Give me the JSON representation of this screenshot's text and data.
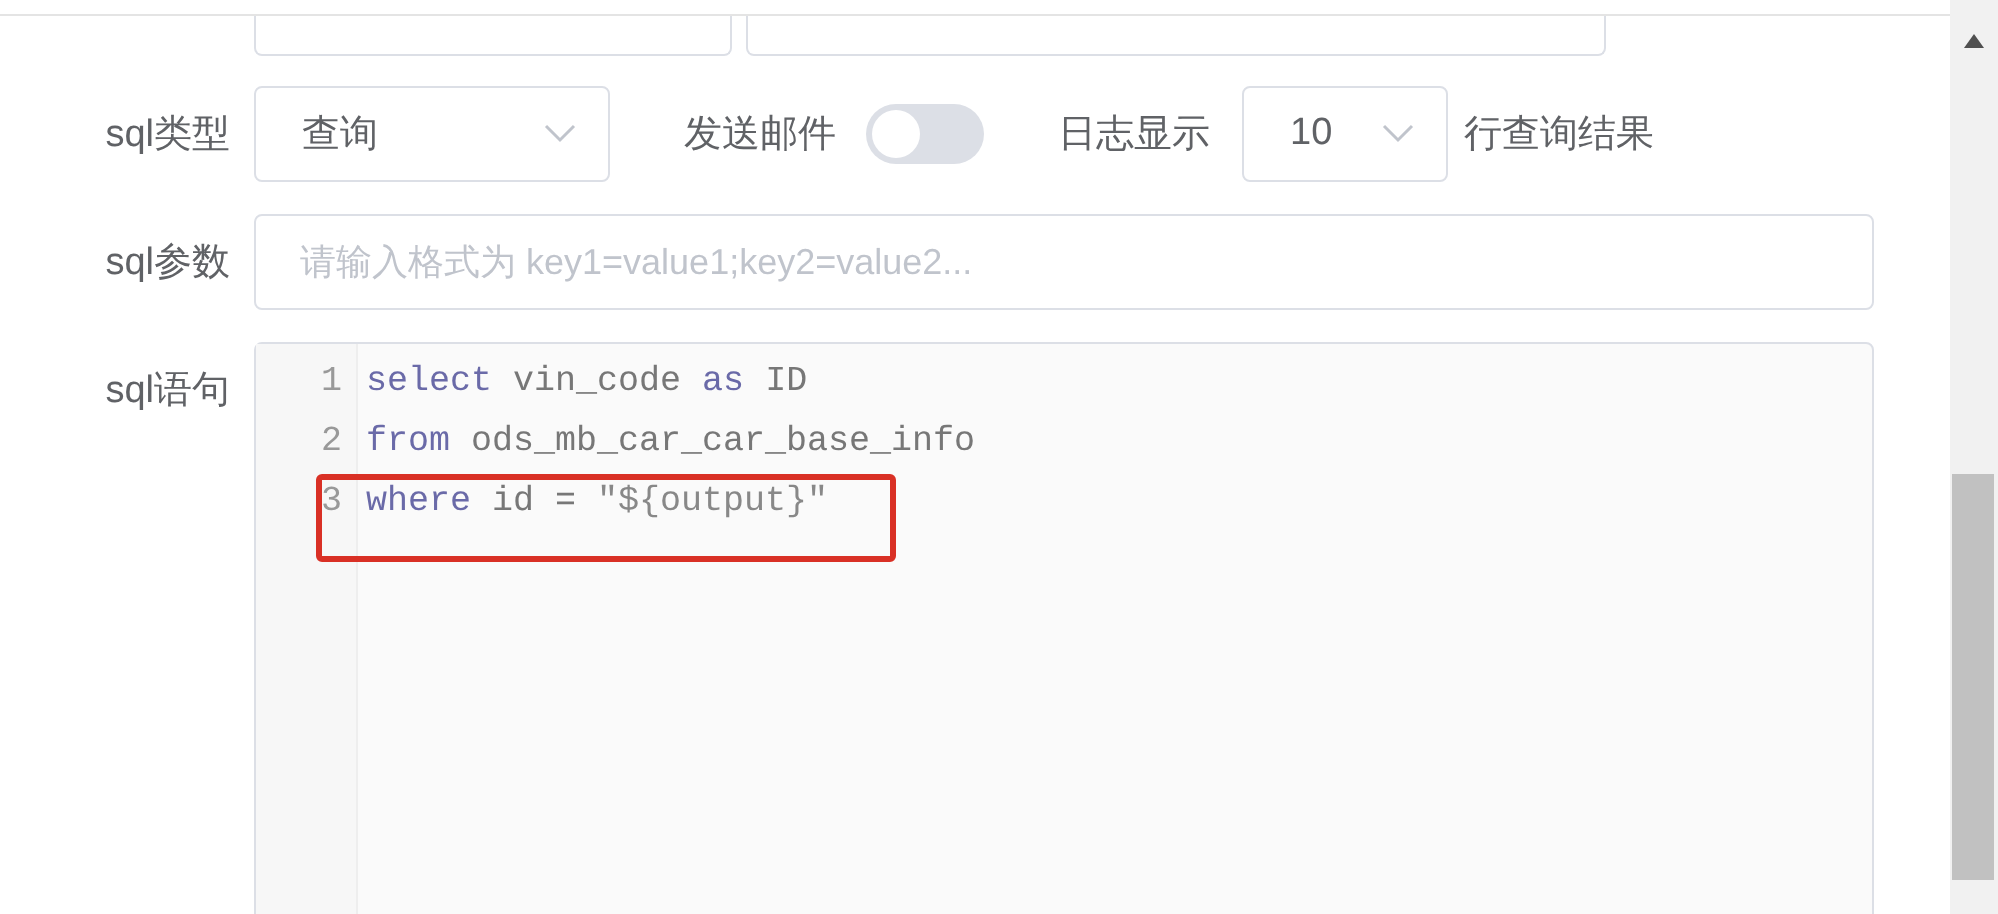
{
  "form": {
    "query_row": {
      "label": "sql类型",
      "type_select": {
        "value": "查询"
      },
      "mail_label": "发送邮件",
      "mail_toggle": {
        "on": false
      },
      "log_label": "日志显示",
      "log_select": {
        "value": "10"
      },
      "log_suffix": "行查询结果"
    },
    "params_row": {
      "label": "sql参数",
      "placeholder": "请输入格式为 key1=value1;key2=value2..."
    },
    "statement_row": {
      "label": "sql语句",
      "lines": [
        {
          "number": "1",
          "highlighted": false,
          "tokens": [
            {
              "text": "select",
              "kind": "keyword"
            },
            {
              "text": " vin_code ",
              "kind": "plain"
            },
            {
              "text": "as",
              "kind": "keyword"
            },
            {
              "text": " ID",
              "kind": "plain"
            }
          ]
        },
        {
          "number": "2",
          "highlighted": false,
          "tokens": [
            {
              "text": "from",
              "kind": "keyword"
            },
            {
              "text": " ods_mb_car_car_base_info",
              "kind": "plain"
            }
          ]
        },
        {
          "number": "3",
          "highlighted": true,
          "tokens": [
            {
              "text": "where",
              "kind": "keyword"
            },
            {
              "text": " id = ",
              "kind": "plain"
            },
            {
              "text": "\"${output}\"",
              "kind": "string"
            }
          ]
        }
      ]
    }
  }
}
